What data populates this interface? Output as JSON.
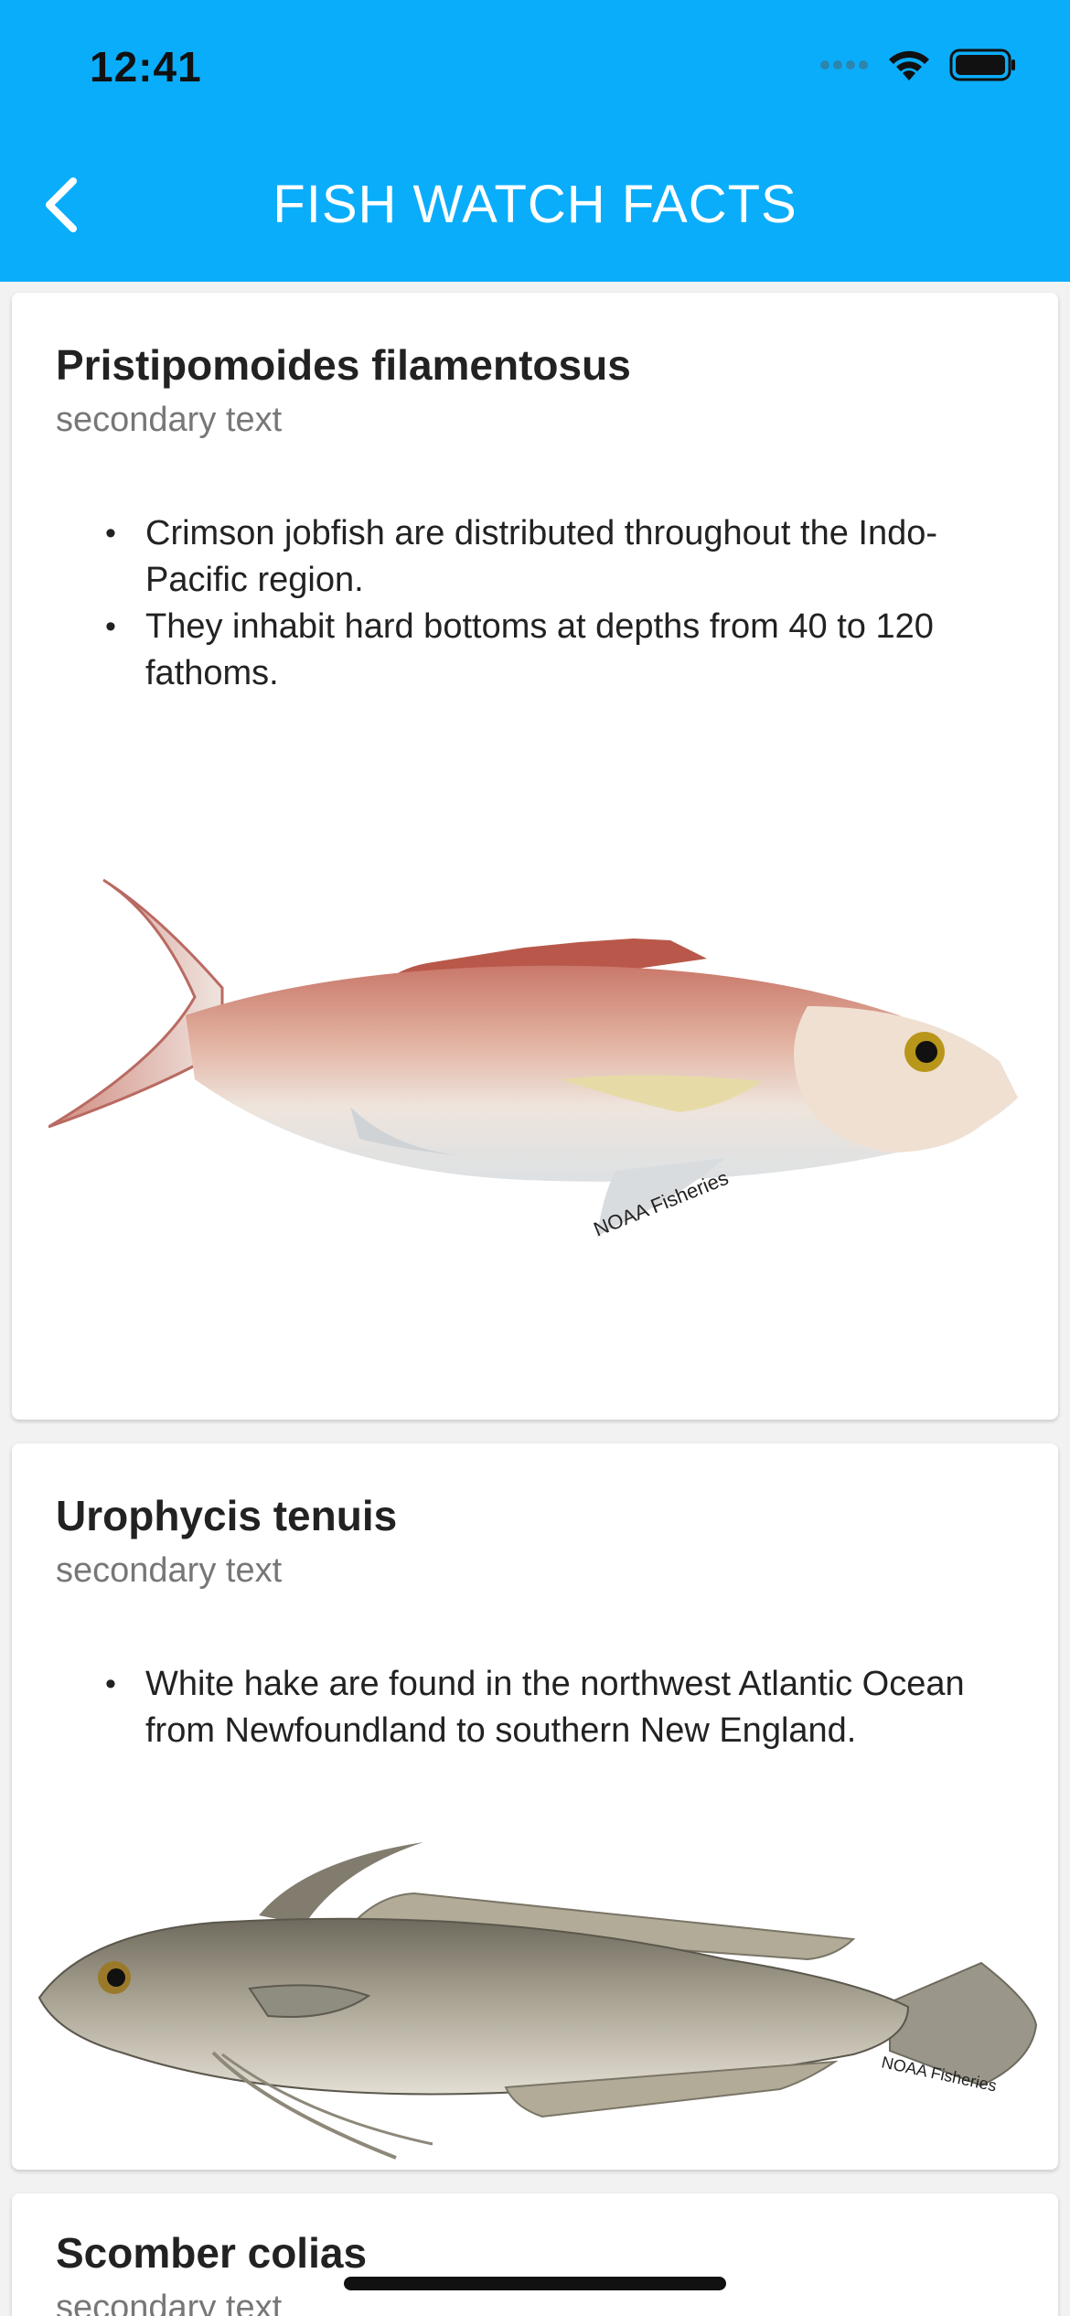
{
  "status_bar": {
    "time": "12:41",
    "signal_icon": "signal-dots-icon",
    "wifi_icon": "wifi-icon",
    "battery_icon": "battery-icon"
  },
  "header": {
    "title": "FISH WATCH FACTS",
    "back_icon": "chevron-left-icon",
    "background": "#0aadfa"
  },
  "cards": [
    {
      "title": "Pristipomoides filamentosus",
      "subtitle": "secondary text",
      "facts": [
        "Crimson jobfish are distributed throughout the Indo-Pacific region.",
        "They inhabit hard bottoms at depths from 40 to 120 fathoms."
      ],
      "image_caption": "NOAA Fisheries"
    },
    {
      "title": "Urophycis tenuis",
      "subtitle": "secondary text",
      "facts": [
        "White hake are found in the northwest Atlantic Ocean from Newfoundland to southern New England."
      ],
      "image_caption": "NOAA Fisheries"
    },
    {
      "title": "Scomber colias",
      "subtitle": "secondary text"
    }
  ]
}
